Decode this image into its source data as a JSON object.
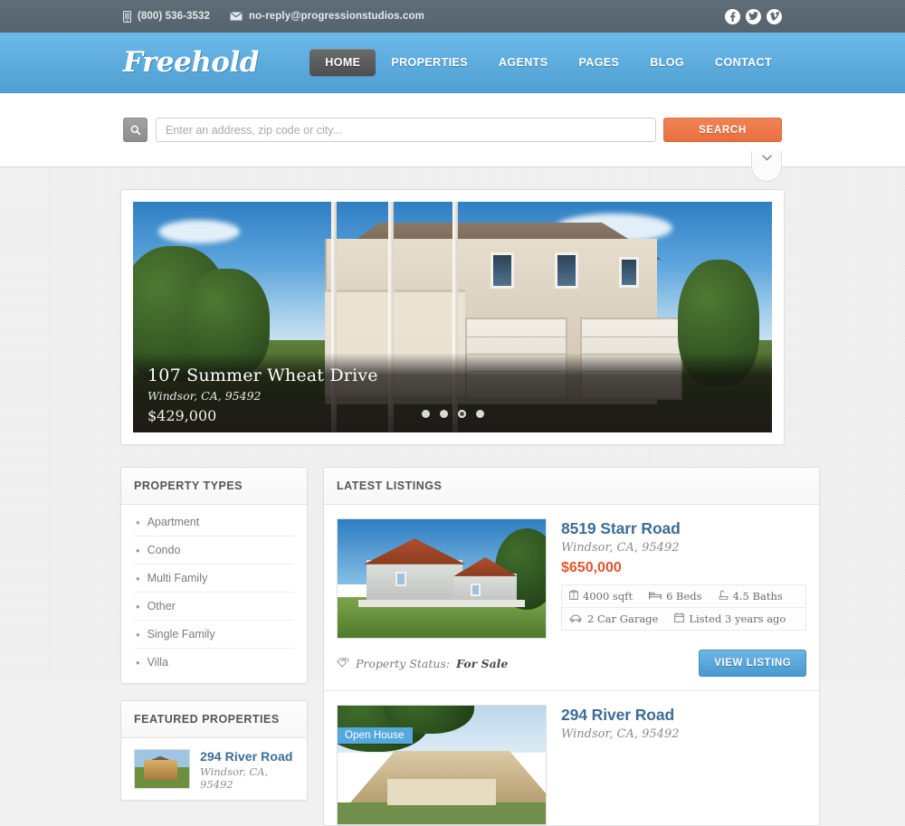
{
  "topbar": {
    "phone": "(800) 536-3532",
    "email": "no-reply@progressionstudios.com",
    "phone_icon": "mobile-phone-icon",
    "email_icon": "envelope-icon",
    "social": [
      {
        "name": "facebook",
        "glyph": "f"
      },
      {
        "name": "twitter",
        "glyph": "t"
      },
      {
        "name": "vimeo",
        "glyph": "v"
      }
    ]
  },
  "header": {
    "logo": "Freehold",
    "nav": [
      {
        "label": "HOME",
        "active": true
      },
      {
        "label": "PROPERTIES",
        "active": false
      },
      {
        "label": "AGENTS",
        "active": false
      },
      {
        "label": "PAGES",
        "active": false
      },
      {
        "label": "BLOG",
        "active": false
      },
      {
        "label": "CONTACT",
        "active": false
      }
    ]
  },
  "search": {
    "placeholder": "Enter an address, zip code or city...",
    "value": "",
    "button_label": "SEARCH",
    "search_icon": "magnifier-icon",
    "toggle_icon": "chevron-down-icon"
  },
  "hero": {
    "title": "107 Summer Wheat Drive",
    "address": "Windsor, CA, 95492",
    "price": "$429,000",
    "dots": 4,
    "active_dot": 3
  },
  "sidebar": {
    "property_types": {
      "heading": "PROPERTY TYPES",
      "items": [
        "Apartment",
        "Condo",
        "Multi Family",
        "Other",
        "Single Family",
        "Villa"
      ]
    },
    "featured": {
      "heading": "FEATURED PROPERTIES",
      "items": [
        {
          "title": "294 River Road",
          "address": "Windsor, CA, 95492"
        }
      ]
    }
  },
  "main": {
    "heading": "LATEST LISTINGS",
    "listings": [
      {
        "title": "8519 Starr Road",
        "address": "Windsor, CA, 95492",
        "price": "$650,000",
        "specs_row1": [
          {
            "icon": "area-icon",
            "label": "4000 sqft"
          },
          {
            "icon": "bed-icon",
            "label": "6 Beds"
          },
          {
            "icon": "bath-icon",
            "label": "4.5 Baths"
          }
        ],
        "specs_row2": [
          {
            "icon": "car-icon",
            "label": "2 Car Garage"
          },
          {
            "icon": "calendar-icon",
            "label": "Listed 3 years ago"
          }
        ],
        "status_icon": "tag-icon",
        "status_label": "Property Status:",
        "status_value": "For Sale",
        "button_label": "VIEW LISTING",
        "badge": ""
      },
      {
        "title": "294 River Road",
        "address": "Windsor, CA, 95492",
        "price": "",
        "specs_row1": [],
        "specs_row2": [],
        "status_icon": "tag-icon",
        "status_label": "",
        "status_value": "",
        "button_label": "",
        "badge": "Open House"
      }
    ]
  },
  "colors": {
    "header_blue": "#5faedf",
    "topbar_gray": "#5a6a74",
    "accent_orange": "#e2562b",
    "search_button": "#ed7a4a",
    "link_blue": "#3d6d96",
    "button_blue": "#57a5d6",
    "page_bg": "#f1f1f1"
  }
}
